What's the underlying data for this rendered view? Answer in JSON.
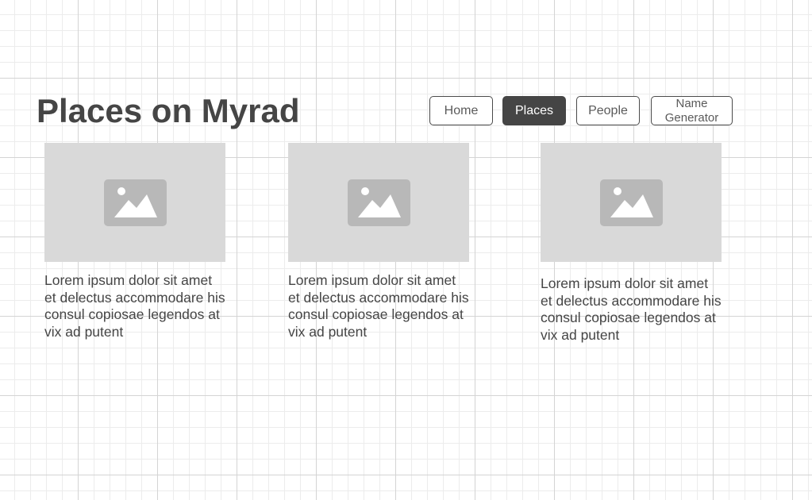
{
  "page": {
    "title": "Places on Myrad"
  },
  "nav": {
    "items": [
      {
        "label": "Home",
        "active": false
      },
      {
        "label": "Places",
        "active": true
      },
      {
        "label": "People",
        "active": false
      },
      {
        "label": "Name\nGenerator",
        "active": false
      }
    ]
  },
  "cards": [
    {
      "image_icon": "image-placeholder-icon",
      "text": "Lorem ipsum dolor sit amet et delectus accommodare his consul copiosae legendos at vix ad putent"
    },
    {
      "image_icon": "image-placeholder-icon",
      "text": "Lorem ipsum dolor sit amet et delectus accommodare his consul copiosae legendos at vix ad putent"
    },
    {
      "image_icon": "image-placeholder-icon",
      "text": "Lorem ipsum dolor sit amet et delectus accommodare his consul copiosae legendos at vix ad putent"
    }
  ],
  "colors": {
    "active_button_bg": "#454545",
    "placeholder_bg": "#d9d9d9",
    "placeholder_icon": "#b8b8b8"
  }
}
